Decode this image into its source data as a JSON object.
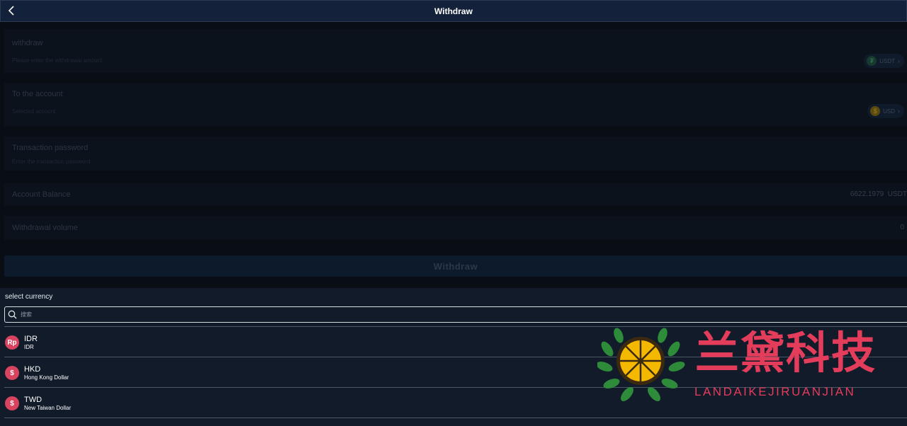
{
  "header": {
    "title": "Withdraw"
  },
  "form": {
    "withdraw": {
      "label": "withdraw",
      "placeholder": "Please enter the withdrawal amount",
      "currency": "USDT"
    },
    "account": {
      "label": "To the account",
      "placeholder": "Selected account",
      "currency": "USD"
    },
    "password": {
      "label": "Transaction password",
      "placeholder": "Enter the transaction password"
    },
    "balance": {
      "label": "Account Balance",
      "value": "6622.1979",
      "unit": "USDT"
    },
    "volume": {
      "label": "Withdrawal volume",
      "value": "0"
    },
    "submit_label": "Withdraw"
  },
  "sheet": {
    "title": "select currency",
    "search_placeholder": "搜索",
    "currencies": [
      {
        "symbol": "Rp",
        "code": "IDR",
        "name": "IDR"
      },
      {
        "symbol": "$",
        "code": "HKD",
        "name": "Hong Kong Dollar"
      },
      {
        "symbol": "$",
        "code": "TWD",
        "name": "New Taiwan Dollar"
      }
    ]
  },
  "watermark": {
    "chinese": "兰黛科技",
    "pinyin": "LANDAIKEJIRUANJIAN"
  },
  "colors": {
    "accent": "#d8435f",
    "header_bg": "#13213a",
    "sheet_bg": "#111b2a",
    "watermark": "#e43c5b"
  },
  "icons": {
    "back": "chevron-left-icon",
    "search": "search-icon",
    "usdt": "tether-coin-icon",
    "usd": "dollar-coin-icon"
  }
}
